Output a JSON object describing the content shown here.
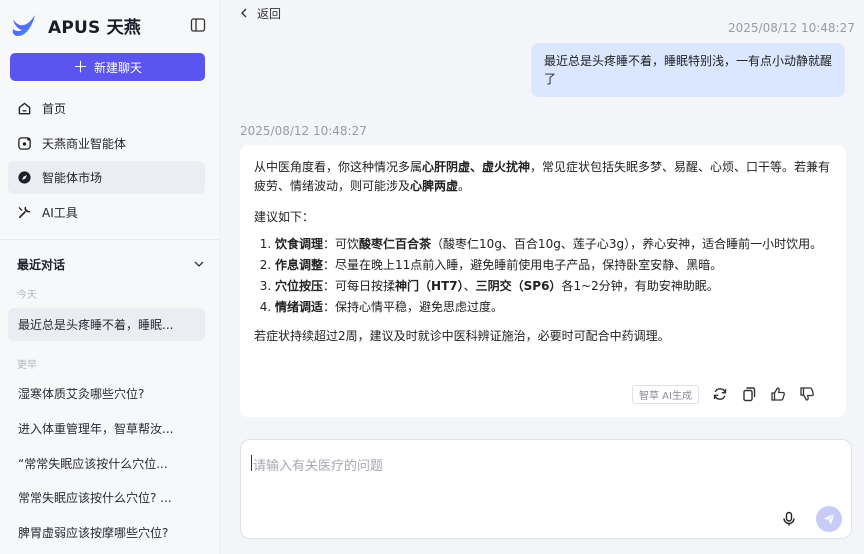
{
  "brand": {
    "name": "APUS 天燕"
  },
  "sidebar": {
    "new_chat_label": "新建聊天",
    "nav": [
      {
        "label": "首页",
        "icon": "home-icon"
      },
      {
        "label": "天燕商业智能体",
        "icon": "agent-icon"
      },
      {
        "label": "智能体市场",
        "icon": "compass-icon"
      },
      {
        "label": "AI工具",
        "icon": "wrench-icon"
      }
    ],
    "recent_title": "最近对话",
    "today_label": "今天",
    "earlier_label": "更早",
    "today_items": [
      "最近总是头疼睡不着，睡眠..."
    ],
    "earlier_items": [
      "湿寒体质艾灸哪些穴位?",
      "进入体重管理年，智草帮汝...",
      "“常常失眠应该按什么穴位...",
      "常常失眠应该按什么穴位? ...",
      "脾胃虚弱应该按摩哪些穴位?"
    ]
  },
  "main": {
    "back_label": "返回",
    "user_timestamp": "2025/08/12 10:48:27",
    "user_message": "最近总是头疼睡不着，睡眠特别浅，一有点小动静就醒了",
    "ai_timestamp": "2025/08/12 10:48:27",
    "answer": {
      "intro_1": "从中医角度看，你这种情况多属",
      "intro_b1": "心肝阴虚、虚火扰神",
      "intro_2": "，常见症状包括失眠多梦、易醒、心烦、口干等。若兼有疲劳、情绪波动，则可能涉及",
      "intro_b2": "心脾两虚",
      "intro_3": "。",
      "advice_label": "建议如下：",
      "item1_b": "饮食调理",
      "item1_a": "：可饮",
      "item1_b2": "酸枣仁百合茶",
      "item1_c": "（酸枣仁10g、百合10g、莲子心3g），养心安神，适合睡前一小时饮用。",
      "item2_b": "作息调整",
      "item2_c": "：尽量在晚上11点前入睡，避免睡前使用电子产品，保持卧室安静、黑暗。",
      "item3_b": "穴位按压",
      "item3_a": "：可每日按揉",
      "item3_b2": "神门（HT7）",
      "item3_m": "、",
      "item3_b3": "三阴交（SP6）",
      "item3_c": "各1~2分钟，有助安神助眠。",
      "item4_b": "情绪调适",
      "item4_c": "：保持心情平稳，避免思虑过度。",
      "outro": "若症状持续超过2周，建议及时就诊中医科辨证施治，必要时可配合中药调理。"
    },
    "ai_badge": "智草 AI生成",
    "composer_placeholder": "请输入有关医疗的问题"
  }
}
